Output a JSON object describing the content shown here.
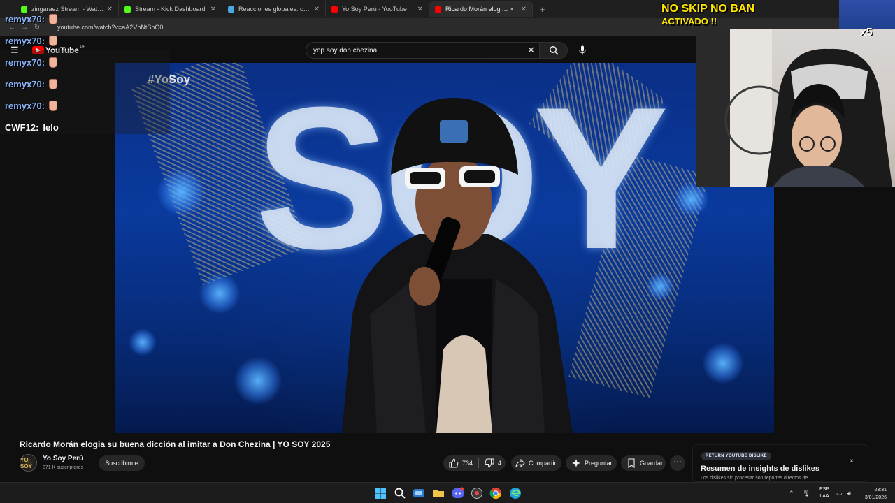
{
  "browser": {
    "tabs": [
      {
        "title": "zingaraez Stream - Watch Live",
        "favicon_color": "#53fc18"
      },
      {
        "title": "Stream - Kick Dashboard",
        "favicon_color": "#53fc18"
      },
      {
        "title": "Reacciones globales: condena...",
        "favicon_color": "#4aa8e0"
      },
      {
        "title": "Yo Soy Perú - YouTube",
        "favicon_color": "#ff0000"
      },
      {
        "title": "Ricardo Morán elogia su bu...",
        "favicon_color": "#ff0000",
        "active": true
      }
    ],
    "new_tab_label": "+",
    "url": "youtube.com/watch?v=aA2VhNtSbO0"
  },
  "youtube": {
    "logo_text": "YouTube",
    "country_code": "PE",
    "search_value": "yop soy don chezina",
    "video_overlay_text": "#YoSoy",
    "video_big_text": "SOY",
    "video_title": "Ricardo Morán elogia su buena dicción al imitar a Don Chezina | YO SOY 2025",
    "channel": {
      "avatar_text": "YO SOY",
      "name": "Yo Soy Perú",
      "subscribers": "871 K suscriptores",
      "subscribe_label": "Suscribirme"
    },
    "actions": {
      "likes": "734",
      "dislikes": "4",
      "share": "Compartir",
      "ask": "Preguntar",
      "save": "Guardar",
      "more": "⋯"
    },
    "ryd": {
      "badge": "RETURN YOUTUBE DISLIKE",
      "title": "Resumen de insights de dislikes",
      "subtitle": "Los dislikes sin procesar son reportes directos de",
      "close": "×"
    }
  },
  "stream_overlay": {
    "banner_line1": "NO SKIP NO BAN",
    "banner_line2": "ACTIVADO !!",
    "multiplier": "x5",
    "chat": [
      {
        "user": "remyx70:",
        "msg": "",
        "emote": true
      },
      {
        "user": "remyx70:",
        "msg": "",
        "emote": true
      },
      {
        "user": "remyx70:",
        "msg": "",
        "emote": true
      },
      {
        "user": "remyx70:",
        "msg": "",
        "emote": true
      },
      {
        "user": "remyx70:",
        "msg": "",
        "emote": true
      },
      {
        "user": "CWF12:",
        "msg": "lelo",
        "emote": false
      }
    ]
  },
  "taskbar": {
    "lang_line1": "ESP",
    "lang_line2": "LAA",
    "time": "23:31",
    "date": "3/01/2026"
  }
}
